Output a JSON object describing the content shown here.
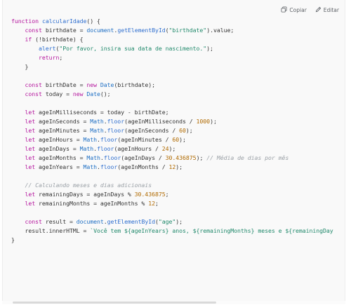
{
  "toolbar": {
    "copy_label": "Copiar",
    "edit_label": "Editar",
    "copy_icon": "copy-icon",
    "edit_icon": "pencil-icon"
  },
  "code_lines": [
    [
      [
        "kw",
        "function"
      ],
      [
        "p",
        " "
      ],
      [
        "fn",
        "calcularIdade"
      ],
      [
        "p",
        "() {"
      ]
    ],
    [
      [
        "p",
        "    "
      ],
      [
        "kw",
        "const"
      ],
      [
        "p",
        " birthdate = "
      ],
      [
        "cls",
        "document"
      ],
      [
        "p",
        "."
      ],
      [
        "fn",
        "getElementById"
      ],
      [
        "p",
        "("
      ],
      [
        "str",
        "\"birthdate\""
      ],
      [
        "p",
        ").value;"
      ]
    ],
    [
      [
        "p",
        "    "
      ],
      [
        "kw",
        "if"
      ],
      [
        "p",
        " (!birthdate) {"
      ]
    ],
    [
      [
        "p",
        "        "
      ],
      [
        "fn",
        "alert"
      ],
      [
        "p",
        "("
      ],
      [
        "str",
        "\"Por favor, insira sua data de nascimento.\""
      ],
      [
        "p",
        ");"
      ]
    ],
    [
      [
        "p",
        "        "
      ],
      [
        "kw",
        "return"
      ],
      [
        "p",
        ";"
      ]
    ],
    [
      [
        "p",
        "    }"
      ]
    ],
    [
      [
        "p",
        ""
      ]
    ],
    [
      [
        "p",
        "    "
      ],
      [
        "kw",
        "const"
      ],
      [
        "p",
        " birthDate = "
      ],
      [
        "kw",
        "new"
      ],
      [
        "p",
        " "
      ],
      [
        "cls",
        "Date"
      ],
      [
        "p",
        "(birthdate);"
      ]
    ],
    [
      [
        "p",
        "    "
      ],
      [
        "kw",
        "const"
      ],
      [
        "p",
        " today = "
      ],
      [
        "kw",
        "new"
      ],
      [
        "p",
        " "
      ],
      [
        "cls",
        "Date"
      ],
      [
        "p",
        "();"
      ]
    ],
    [
      [
        "p",
        ""
      ]
    ],
    [
      [
        "p",
        "    "
      ],
      [
        "kw",
        "let"
      ],
      [
        "p",
        " ageInMilliseconds = today - birthDate;"
      ]
    ],
    [
      [
        "p",
        "    "
      ],
      [
        "kw",
        "let"
      ],
      [
        "p",
        " ageInSeconds = "
      ],
      [
        "cls",
        "Math"
      ],
      [
        "p",
        "."
      ],
      [
        "fn",
        "floor"
      ],
      [
        "p",
        "(ageInMilliseconds / "
      ],
      [
        "num",
        "1000"
      ],
      [
        "p",
        ");"
      ]
    ],
    [
      [
        "p",
        "    "
      ],
      [
        "kw",
        "let"
      ],
      [
        "p",
        " ageInMinutes = "
      ],
      [
        "cls",
        "Math"
      ],
      [
        "p",
        "."
      ],
      [
        "fn",
        "floor"
      ],
      [
        "p",
        "(ageInSeconds / "
      ],
      [
        "num",
        "60"
      ],
      [
        "p",
        ");"
      ]
    ],
    [
      [
        "p",
        "    "
      ],
      [
        "kw",
        "let"
      ],
      [
        "p",
        " ageInHours = "
      ],
      [
        "cls",
        "Math"
      ],
      [
        "p",
        "."
      ],
      [
        "fn",
        "floor"
      ],
      [
        "p",
        "(ageInMinutes / "
      ],
      [
        "num",
        "60"
      ],
      [
        "p",
        ");"
      ]
    ],
    [
      [
        "p",
        "    "
      ],
      [
        "kw",
        "let"
      ],
      [
        "p",
        " ageInDays = "
      ],
      [
        "cls",
        "Math"
      ],
      [
        "p",
        "."
      ],
      [
        "fn",
        "floor"
      ],
      [
        "p",
        "(ageInHours / "
      ],
      [
        "num",
        "24"
      ],
      [
        "p",
        ");"
      ]
    ],
    [
      [
        "p",
        "    "
      ],
      [
        "kw",
        "let"
      ],
      [
        "p",
        " ageInMonths = "
      ],
      [
        "cls",
        "Math"
      ],
      [
        "p",
        "."
      ],
      [
        "fn",
        "floor"
      ],
      [
        "p",
        "(ageInDays / "
      ],
      [
        "num",
        "30.436875"
      ],
      [
        "p",
        "); "
      ],
      [
        "cmt",
        "// Média de dias por mês"
      ]
    ],
    [
      [
        "p",
        "    "
      ],
      [
        "kw",
        "let"
      ],
      [
        "p",
        " ageInYears = "
      ],
      [
        "cls",
        "Math"
      ],
      [
        "p",
        "."
      ],
      [
        "fn",
        "floor"
      ],
      [
        "p",
        "(ageInMonths / "
      ],
      [
        "num",
        "12"
      ],
      [
        "p",
        ");"
      ]
    ],
    [
      [
        "p",
        ""
      ]
    ],
    [
      [
        "p",
        "    "
      ],
      [
        "cmt",
        "// Calculando meses e dias adicionais"
      ]
    ],
    [
      [
        "p",
        "    "
      ],
      [
        "kw",
        "let"
      ],
      [
        "p",
        " remainingDays = ageInDays % "
      ],
      [
        "num",
        "30.436875"
      ],
      [
        "p",
        ";"
      ]
    ],
    [
      [
        "p",
        "    "
      ],
      [
        "kw",
        "let"
      ],
      [
        "p",
        " remainingMonths = ageInMonths % "
      ],
      [
        "num",
        "12"
      ],
      [
        "p",
        ";"
      ]
    ],
    [
      [
        "p",
        ""
      ]
    ],
    [
      [
        "p",
        "    "
      ],
      [
        "kw",
        "const"
      ],
      [
        "p",
        " result = "
      ],
      [
        "cls",
        "document"
      ],
      [
        "p",
        "."
      ],
      [
        "fn",
        "getElementById"
      ],
      [
        "p",
        "("
      ],
      [
        "str",
        "\"age\""
      ],
      [
        "p",
        ");"
      ]
    ],
    [
      [
        "p",
        "    result.innerHTML = "
      ],
      [
        "str",
        "`Você tem ${ageInYears} anos, ${remainingMonths} meses e ${remainingDay"
      ]
    ],
    [
      [
        "p",
        "}"
      ]
    ]
  ],
  "colors": {
    "keyword": "#b5179e",
    "function": "#2f6fcf",
    "string": "#20896b",
    "number": "#b06a00",
    "comment": "#9aa0a6",
    "background": "#f9f9f9"
  }
}
